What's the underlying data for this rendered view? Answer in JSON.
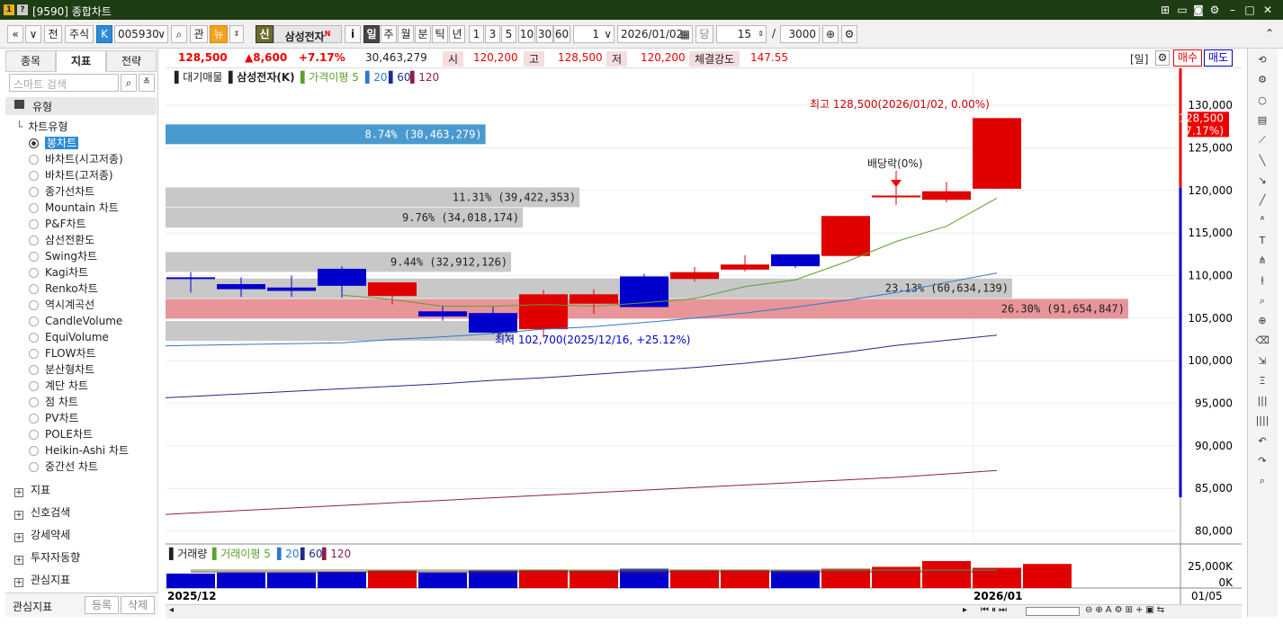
{
  "window": {
    "title": "[9590] 종합차트",
    "icon_one": "1",
    "icon_question": "?"
  },
  "window_buttons": [
    "pin-icon",
    "window-icon",
    "camera-icon",
    "gear-icon",
    "minimize-icon",
    "maximize-icon",
    "close-icon"
  ],
  "toolbar": {
    "nav_back": "«",
    "nav_down": "»",
    "jeon": "전",
    "market": "주식",
    "k_badge": "K",
    "code": "005930",
    "gwan": "관",
    "news": "뉴",
    "sin_badge": "신",
    "stock_name": "삼성전자",
    "n_mark": "N",
    "info": "i",
    "periods": [
      "일",
      "주",
      "월",
      "분",
      "틱",
      "년"
    ],
    "intervals": [
      "1",
      "3",
      "5",
      "10",
      "30",
      "60"
    ],
    "interval_value": "1",
    "date": "2026/01/02",
    "dang": "당",
    "count": "15",
    "slash": "/",
    "total": "3000"
  },
  "left_panel": {
    "tabs": [
      "종목",
      "지표",
      "전략"
    ],
    "search_placeholder": "스마트 검색",
    "section_type": "유형",
    "chart_type_header": "차트유형",
    "chart_types": [
      "봉차트",
      "바차트(시고저종)",
      "바차트(고저종)",
      "종가선차트",
      "Mountain 차트",
      "P&F차트",
      "삼선전환도",
      "Swing차트",
      "Kagi차트",
      "Renko차트",
      "역시계곡선",
      "CandleVolume",
      "EquiVolume",
      "FLOW차트",
      "분산형차트",
      "계단 차트",
      "점 차트",
      "PV차트",
      "POLE차트",
      "Heikin-Ashi 차트",
      "중간선 차트"
    ],
    "sections": [
      "지표",
      "신호검색",
      "강세약세",
      "투자자동향",
      "관심지표"
    ],
    "footer_label": "관심지표",
    "register": "등록",
    "delete": "삭제"
  },
  "info_bar": {
    "price": "128,500",
    "change": "▲8,600",
    "change_pct": "+7.17%",
    "volume": "30,463,279",
    "open_label": "시",
    "open": "120,200",
    "high_label": "고",
    "high": "128,500",
    "low_label": "저",
    "low": "120,200",
    "strength_label": "체결강도",
    "strength": "147.55",
    "period_tag": "[일]",
    "buy": "매수",
    "sell": "매도"
  },
  "legend": {
    "volume_profile": "대기매물",
    "stock": "삼성전자(K)",
    "ma_title": "가격이평",
    "ma": [
      "5",
      "20",
      "60",
      "120"
    ],
    "vol_title": "거래량",
    "vol_ma_title": "거래이평",
    "vol_ma": [
      "5",
      "20",
      "60",
      "120"
    ]
  },
  "colors": {
    "up": "#e00000",
    "down": "#0000cc",
    "ma5": "#5aa02c",
    "ma20": "#2a7ad0",
    "ma60": "#1e2a8e",
    "ma120": "#8e1e4e",
    "profile": "#c8c8c8",
    "profile_hi": "#e8959a",
    "profile_top": "#4a9ad0"
  },
  "annotations": {
    "high_note": "최고 128,500(2026/01/02, 0.00%)",
    "low_note": "최저 102,700(2025/12/16, +25.12%)",
    "dividend": "배당락(0%)",
    "price_tag": "128,500",
    "price_tag_pct": "(7.17%)"
  },
  "chart_data": {
    "type": "candlestick",
    "price_range": [
      79000,
      133500
    ],
    "y_ticks": [
      "130,000",
      "125,000",
      "120,000",
      "115,000",
      "110,000",
      "105,000",
      "100,000",
      "95,000",
      "90,000",
      "85,000",
      "80,000"
    ],
    "x_labels": [
      "2025/12",
      "2026/01"
    ],
    "date_label": "01/05",
    "vol_ticks": [
      "25,000K",
      "0K"
    ],
    "candles": [
      {
        "o": 109800,
        "h": 110400,
        "l": 108000,
        "c": 109600
      },
      {
        "o": 109000,
        "h": 109800,
        "l": 107500,
        "c": 108400
      },
      {
        "o": 108600,
        "h": 110000,
        "l": 107500,
        "c": 108200
      },
      {
        "o": 110800,
        "h": 111100,
        "l": 107400,
        "c": 108800
      },
      {
        "o": 107600,
        "h": 109200,
        "l": 106600,
        "c": 109200
      },
      {
        "o": 105800,
        "h": 106500,
        "l": 104700,
        "c": 105200
      },
      {
        "o": 105600,
        "h": 106300,
        "l": 103100,
        "c": 103300
      },
      {
        "o": 103700,
        "h": 108300,
        "l": 102700,
        "c": 107800
      },
      {
        "o": 106700,
        "h": 108400,
        "l": 105500,
        "c": 107800
      },
      {
        "o": 109900,
        "h": 110200,
        "l": 106300,
        "c": 106300
      },
      {
        "o": 109600,
        "h": 111000,
        "l": 109300,
        "c": 110400
      },
      {
        "o": 110700,
        "h": 112400,
        "l": 110500,
        "c": 111300
      },
      {
        "o": 112500,
        "h": 112500,
        "l": 110900,
        "c": 111100
      },
      {
        "o": 112300,
        "h": 117000,
        "l": 112300,
        "c": 117000
      },
      {
        "o": 119400,
        "h": 120500,
        "l": 118300,
        "c": 119400
      },
      {
        "o": 118900,
        "h": 121000,
        "l": 118600,
        "c": 119900
      },
      {
        "o": 120200,
        "h": 128500,
        "l": 120200,
        "c": 128500
      }
    ],
    "ma5": [
      null,
      null,
      null,
      null,
      107700,
      107200,
      106400,
      106400,
      106600,
      106400,
      106800,
      107300,
      108700,
      109500,
      111600,
      114000,
      115800,
      119100
    ],
    "ma20": [
      101700,
      101800,
      101900,
      102000,
      102100,
      102500,
      102800,
      103200,
      103700,
      104000,
      104500,
      105000,
      105600,
      106300,
      107100,
      108000,
      109200,
      110300
    ],
    "ma60": [
      94600,
      94900,
      95200,
      95500,
      95800,
      96100,
      96400,
      96700,
      97000,
      97300,
      97700,
      98000,
      98400,
      98800,
      99200,
      99700,
      100300,
      101000,
      101800,
      102400,
      103000
    ],
    "ma120": [
      80300,
      80600,
      80900,
      81200,
      81500,
      81800,
      82100,
      82400,
      82700,
      83000,
      83300,
      83600,
      83900,
      84200,
      84500,
      84800,
      85100,
      85400,
      85700,
      86000,
      86300,
      86700,
      87100
    ],
    "volume_profile": [
      {
        "label": "8.74% (30,463,279)",
        "price": 126600,
        "pct": 8.74
      },
      {
        "label": "11.31% (39,422,353)",
        "price": 119200,
        "pct": 11.31
      },
      {
        "label": "9.76% (34,018,174)",
        "price": 116800,
        "pct": 9.76
      },
      {
        "label": "9.44% (32,912,126)",
        "price": 111600,
        "pct": 9.44
      },
      {
        "label": "23.13% (60,634,139)",
        "price": 108500,
        "pct": 23.13
      },
      {
        "label": "26.30% (91,654,847)",
        "price": 106100,
        "pct": 26.3
      },
      {
        "label": "3)",
        "price": 103500,
        "pct": 9.5
      }
    ],
    "volumes": [
      15,
      16,
      16,
      17,
      18,
      16,
      18,
      19,
      18,
      20,
      19,
      19,
      18,
      20,
      22,
      28,
      21,
      25
    ]
  }
}
